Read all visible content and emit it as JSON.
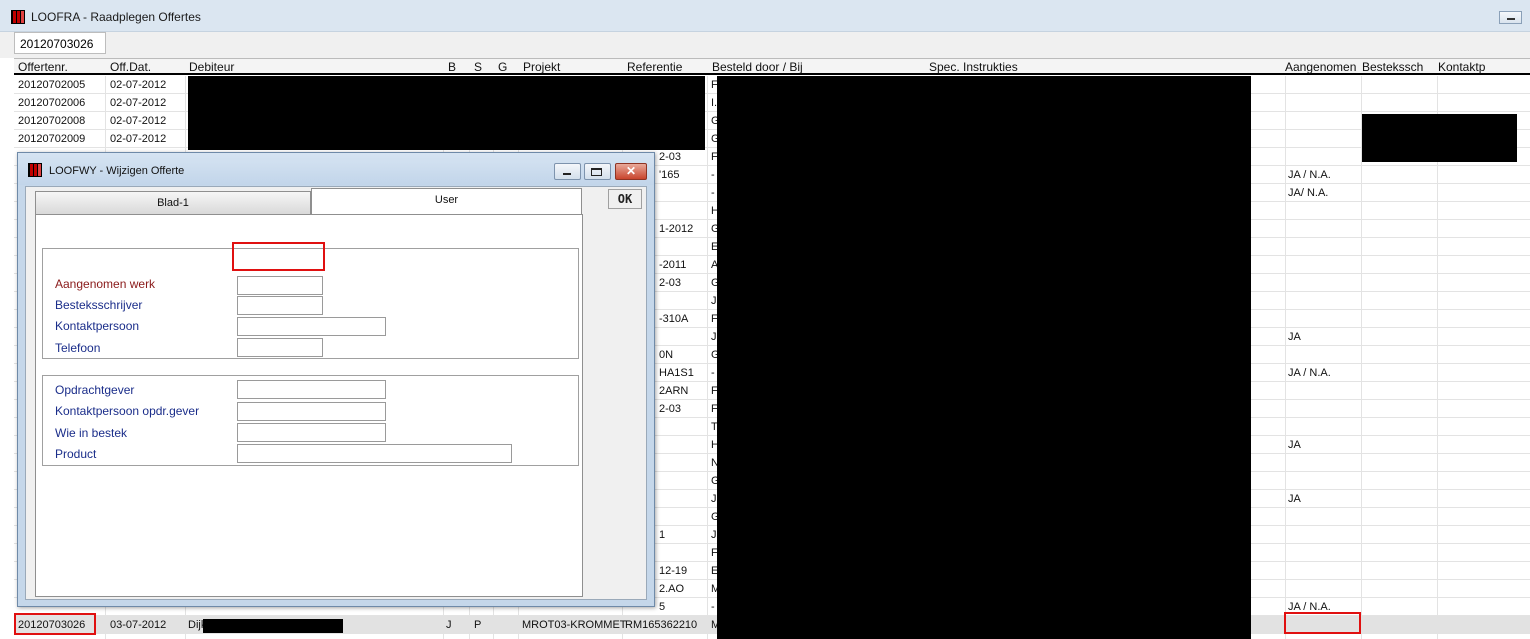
{
  "window": {
    "title": "LOOFRA - Raadplegen Offertes"
  },
  "search": {
    "value": "20120703026"
  },
  "grid": {
    "columns": [
      "Offertenr.",
      "Off.Dat.",
      "Debiteur",
      "B",
      "S",
      "G",
      "Projekt",
      "Referentie",
      "Besteld door / Bij",
      "Spec. Instrukties",
      "Aangenomen",
      "Bestekssch",
      "Kontaktp"
    ],
    "rows": [
      {
        "offertenr": "20120702005",
        "datum": "02-07-2012",
        "referentie": "",
        "besteld": "F",
        "aangenomen": ""
      },
      {
        "offertenr": "20120702006",
        "datum": "02-07-2012",
        "referentie": "",
        "besteld": "I.",
        "aangenomen": ""
      },
      {
        "offertenr": "20120702008",
        "datum": "02-07-2012",
        "referentie": "",
        "besteld": "G",
        "aangenomen": ""
      },
      {
        "offertenr": "20120702009",
        "datum": "02-07-2012",
        "referentie": "",
        "besteld": "G",
        "aangenomen": ""
      },
      {
        "offertenr": "",
        "datum": "",
        "referentie": "2-03",
        "besteld": "F",
        "aangenomen": ""
      },
      {
        "offertenr": "",
        "datum": "",
        "referentie": "'165",
        "besteld": "-",
        "aangenomen": "JA / N.A."
      },
      {
        "offertenr": "",
        "datum": "",
        "referentie": "",
        "besteld": "-",
        "aangenomen": "JA/ N.A."
      },
      {
        "offertenr": "",
        "datum": "",
        "referentie": "",
        "besteld": "H",
        "aangenomen": ""
      },
      {
        "offertenr": "",
        "datum": "",
        "referentie": "1-2012",
        "besteld": "G",
        "aangenomen": ""
      },
      {
        "offertenr": "",
        "datum": "",
        "referentie": "",
        "besteld": "E",
        "aangenomen": ""
      },
      {
        "offertenr": "",
        "datum": "",
        "referentie": "-2011",
        "besteld": "A",
        "aangenomen": ""
      },
      {
        "offertenr": "",
        "datum": "",
        "referentie": "2-03",
        "besteld": "G",
        "aangenomen": ""
      },
      {
        "offertenr": "",
        "datum": "",
        "referentie": "",
        "besteld": "J",
        "aangenomen": ""
      },
      {
        "offertenr": "",
        "datum": "",
        "referentie": "-310A",
        "besteld": "F",
        "aangenomen": ""
      },
      {
        "offertenr": "",
        "datum": "",
        "referentie": "",
        "besteld": "J",
        "aangenomen": "JA"
      },
      {
        "offertenr": "",
        "datum": "",
        "referentie": "0N",
        "besteld": "G",
        "aangenomen": ""
      },
      {
        "offertenr": "",
        "datum": "",
        "referentie": "HA1S1",
        "besteld": "-",
        "aangenomen": "JA / N.A."
      },
      {
        "offertenr": "",
        "datum": "",
        "referentie": "2ARN",
        "besteld": "F",
        "aangenomen": ""
      },
      {
        "offertenr": "",
        "datum": "",
        "referentie": "2-03",
        "besteld": "F",
        "aangenomen": ""
      },
      {
        "offertenr": "",
        "datum": "",
        "referentie": "",
        "besteld": "T",
        "aangenomen": ""
      },
      {
        "offertenr": "",
        "datum": "",
        "referentie": "",
        "besteld": "H",
        "aangenomen": "JA"
      },
      {
        "offertenr": "",
        "datum": "",
        "referentie": "",
        "besteld": "N",
        "aangenomen": ""
      },
      {
        "offertenr": "",
        "datum": "",
        "referentie": "",
        "besteld": "G",
        "aangenomen": ""
      },
      {
        "offertenr": "",
        "datum": "",
        "referentie": "",
        "besteld": "J",
        "aangenomen": "JA"
      },
      {
        "offertenr": "",
        "datum": "",
        "referentie": "",
        "besteld": "G",
        "aangenomen": ""
      },
      {
        "offertenr": "",
        "datum": "",
        "referentie": "1",
        "besteld": "J",
        "aangenomen": ""
      },
      {
        "offertenr": "",
        "datum": "",
        "referentie": "",
        "besteld": "F",
        "aangenomen": ""
      },
      {
        "offertenr": "",
        "datum": "",
        "referentie": "12-19",
        "besteld": "E",
        "aangenomen": ""
      },
      {
        "offertenr": "",
        "datum": "",
        "referentie": "2.AO",
        "besteld": "M",
        "aangenomen": ""
      },
      {
        "offertenr": "",
        "datum": "",
        "referentie": "5",
        "besteld": "-",
        "aangenomen": "JA / N.A."
      }
    ],
    "selected_row": {
      "offertenr": "20120703026",
      "datum": "03-07-2012",
      "debiteur": "Dijk",
      "b": "J",
      "s": "P",
      "projekt": "MROT03-KROMMET",
      "referentie": "RM165362210",
      "besteld": "M",
      "aangenomen": ""
    }
  },
  "dialog": {
    "title": "LOOFWY - Wijzigen Offerte",
    "tabs": [
      "Blad-1",
      "User"
    ],
    "ok_label": "OK",
    "group1": {
      "aangenomen_label": "Aangenomen werk",
      "aangenomen_value": "",
      "bestek_label": "Besteksschrijver",
      "bestek_value": "",
      "kontakt_label": "Kontaktpersoon",
      "kontakt_value": "",
      "telefoon_label": "Telefoon",
      "telefoon_value": ""
    },
    "group2": {
      "opdracht_label": "Opdrachtgever",
      "opdracht_value": "",
      "kontakt_opdr_label": "Kontaktpersoon opdr.gever",
      "kontakt_opdr_value": "",
      "wie_label": "Wie in bestek",
      "wie_value": "",
      "product_label": "Product",
      "product_value": ""
    }
  }
}
